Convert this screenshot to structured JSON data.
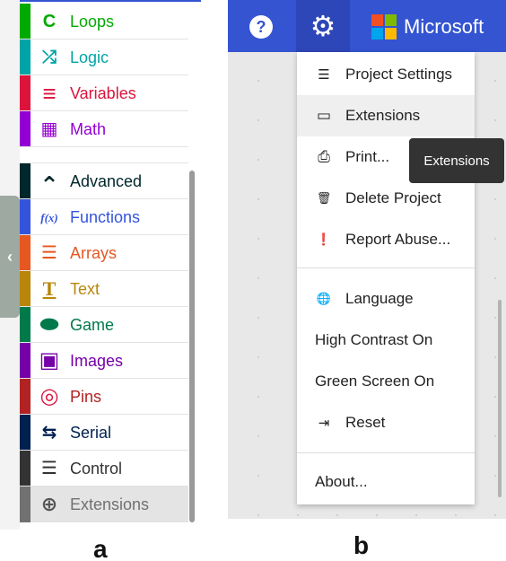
{
  "panel_a": {
    "caption": "a",
    "collapse_glyph": "‹",
    "items": [
      {
        "label": "Loops",
        "icon": "loops-icon",
        "glyph": "C",
        "bar": "#00aa00",
        "color": "#00aa00"
      },
      {
        "label": "Logic",
        "icon": "logic-shuffle-icon",
        "glyph": "⤮",
        "bar": "#00a4a6",
        "color": "#00a4a6"
      },
      {
        "label": "Variables",
        "icon": "variables-icon",
        "glyph": "≡",
        "bar": "#dc143c",
        "color": "#dc143c"
      },
      {
        "label": "Math",
        "icon": "math-calculator-icon",
        "glyph": "▦",
        "bar": "#9400d3",
        "color": "#9400d3"
      },
      {
        "label": "Advanced",
        "icon": "chevron-up-icon",
        "glyph": "⌃",
        "bar": "#00272b",
        "color": "#00272b"
      },
      {
        "label": "Functions",
        "icon": "functions-icon",
        "glyph": "f(x)",
        "bar": "#3455db",
        "color": "#3455db"
      },
      {
        "label": "Arrays",
        "icon": "arrays-list-icon",
        "glyph": "☰",
        "bar": "#e65722",
        "color": "#e65722"
      },
      {
        "label": "Text",
        "icon": "text-icon",
        "glyph": "T",
        "bar": "#b8860b",
        "color": "#b8860b"
      },
      {
        "label": "Game",
        "icon": "game-controller-icon",
        "glyph": "⬬",
        "bar": "#007a4b",
        "color": "#007a4b"
      },
      {
        "label": "Images",
        "icon": "images-icon",
        "glyph": "▣",
        "bar": "#7600a8",
        "color": "#7600a8"
      },
      {
        "label": "Pins",
        "icon": "pins-target-icon",
        "glyph": "◎",
        "bar": "#b22222",
        "color": "#b22222"
      },
      {
        "label": "Serial",
        "icon": "serial-usb-icon",
        "glyph": "⇆",
        "bar": "#002050",
        "color": "#002050"
      },
      {
        "label": "Control",
        "icon": "control-server-icon",
        "glyph": "☰",
        "bar": "#333333",
        "color": "#333333"
      },
      {
        "label": "Extensions",
        "icon": "plus-circle-icon",
        "glyph": "⊕",
        "bar": "#717171",
        "color": "#717171"
      }
    ]
  },
  "panel_b": {
    "caption": "b",
    "help_glyph": "?",
    "gear_glyph": "⚙",
    "brand": "Microsoft",
    "tooltip": "Extensions",
    "menu": [
      {
        "label": "Project Settings",
        "icon": "sliders-icon",
        "glyph": "☰"
      },
      {
        "label": "Extensions",
        "icon": "drive-icon",
        "glyph": "▭"
      },
      {
        "label": "Print...",
        "icon": "printer-icon",
        "glyph": "⎙"
      },
      {
        "label": "Delete Project",
        "icon": "trash-icon",
        "glyph": "🗑"
      },
      {
        "label": "Report Abuse...",
        "icon": "alert-circle-icon",
        "glyph": "❗"
      },
      {
        "label": "Language",
        "icon": "globe-icon",
        "glyph": "🌐"
      },
      {
        "label": "High Contrast On",
        "icon": "",
        "glyph": ""
      },
      {
        "label": "Green Screen On",
        "icon": "",
        "glyph": ""
      },
      {
        "label": "Reset",
        "icon": "reset-icon",
        "glyph": "⇥"
      },
      {
        "label": "About...",
        "icon": "",
        "glyph": ""
      }
    ]
  }
}
